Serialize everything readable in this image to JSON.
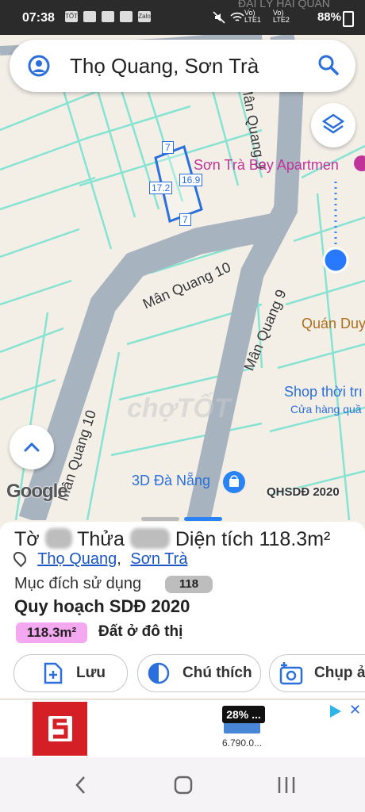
{
  "status_bar": {
    "time": "07:38",
    "notif_icons": [
      "TỐT",
      "folder",
      "check",
      "image",
      "Zalo"
    ],
    "radio_left": "Vo) LTE1",
    "radio_right": "Vo) LTE2",
    "battery": "88%"
  },
  "top_text": "ĐẠI LÝ HẢI QUÂN",
  "search": {
    "title": "Thọ Quang, Sơn Trà"
  },
  "map": {
    "streets": [
      "Mân Quang 9",
      "Mân Quang 10",
      "Mân Quang 9",
      "Mân Quang 10"
    ],
    "poi_apartment": "Sơn Trà Bay Apartmen",
    "poi_quan": "Quán Duy",
    "poi_shop": "Shop thời trı",
    "poi_shop_sub": "Cửa hàng quầ",
    "poi_3d": "3D Đà Nẵng",
    "parcel_top": "7",
    "parcel_bottom": "7",
    "parcel_left": "17.2",
    "parcel_right": "16.9",
    "google_logo": "Google",
    "watermark": "chợTỐT",
    "layer_label": "QHSDĐ 2020",
    "colors": {
      "road": "#a8b3c0",
      "parcel_line": "#7fe0cf",
      "selected": "#2a6fdc",
      "poi_pink": "#c0349a"
    }
  },
  "parcel": {
    "to_label": "Tờ",
    "thua_label": "Thửa",
    "area_label": "Diện tích",
    "area_value": "118.3m²",
    "ward": "Thọ Quang",
    "separator": ",",
    "district": "Sơn Trà",
    "purpose_label": "Mục đích sử dụng",
    "purpose_value": "118",
    "plan_title": "Quy hoạch SDĐ 2020",
    "plan_area": "118.3m²",
    "plan_type": "Đất ở đô thị"
  },
  "actions": {
    "save": "Lưu",
    "legend": "Chú thích",
    "capture": "Chụp ả"
  },
  "ad": {
    "discount": "28% ...",
    "price": "6.790.0..."
  }
}
